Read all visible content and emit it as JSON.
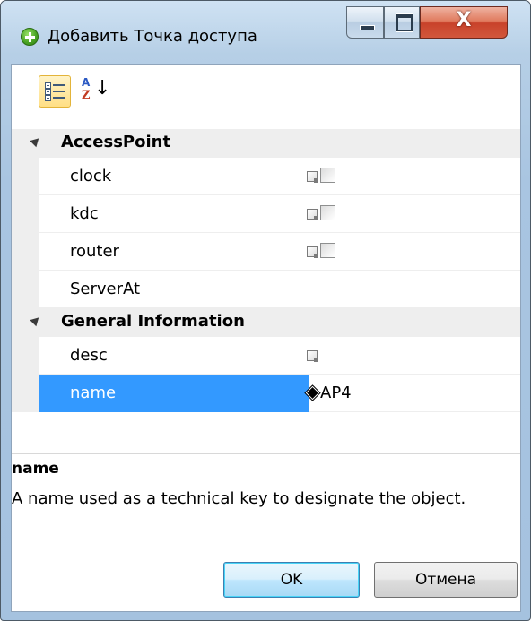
{
  "window": {
    "title": "Добавить Точка доступа",
    "close_glyph": "X"
  },
  "toolbar": {
    "categorized_icon": "categorized-view-icon",
    "sort_icon": "sort-alphabetical-icon",
    "sort_a": "A",
    "sort_z": "Z",
    "sort_arrow": "↓"
  },
  "grid": {
    "categories": [
      {
        "label": "AccessPoint",
        "properties": [
          {
            "name": "clock",
            "has_checkbox": true,
            "checked": false
          },
          {
            "name": "kdc",
            "has_checkbox": true,
            "checked": false
          },
          {
            "name": "router",
            "has_checkbox": true,
            "checked": false
          },
          {
            "name": "ServerAt",
            "has_checkbox": false,
            "value": ""
          }
        ]
      },
      {
        "label": "General Information",
        "properties": [
          {
            "name": "desc",
            "value": ""
          },
          {
            "name": "name",
            "value": "AP4",
            "selected": true
          }
        ]
      }
    ]
  },
  "description": {
    "title": "name",
    "text": "A name used as a technical key to designate the object."
  },
  "buttons": {
    "ok": "OK",
    "cancel": "Отмена"
  },
  "colors": {
    "selection": "#3399ff",
    "category_bg": "#eeeeee",
    "window_frame": "#a9c5e1"
  }
}
